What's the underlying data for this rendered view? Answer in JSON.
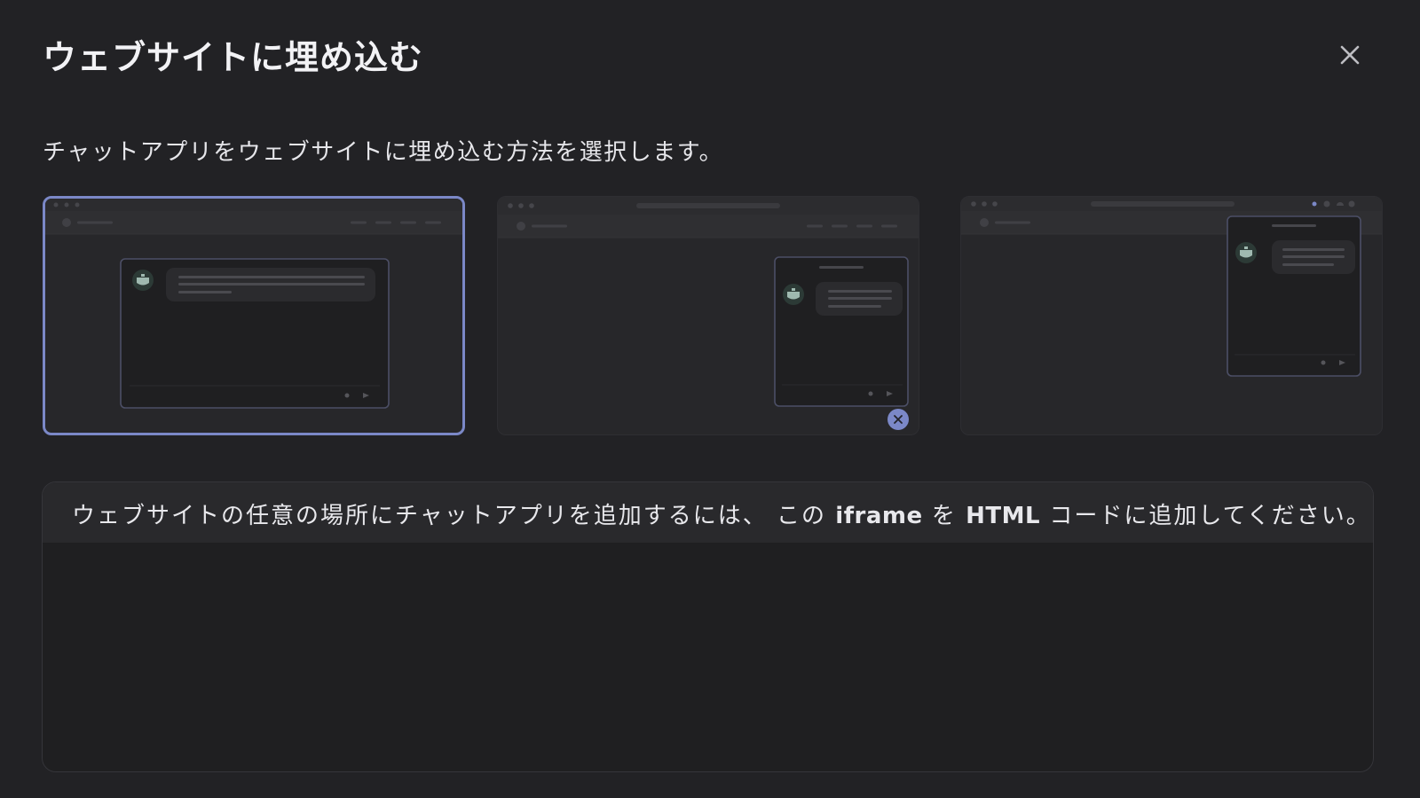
{
  "dialog": {
    "title": "ウェブサイトに埋め込む",
    "close_label": "×",
    "subtitle": "チャットアプリをウェブサイトに埋め込む方法を選択します。"
  },
  "options": [
    {
      "id": "iframe",
      "selected": true
    },
    {
      "id": "floating-bubble",
      "selected": false
    },
    {
      "id": "chrome-extension",
      "selected": false
    }
  ],
  "code_panel": {
    "instruction_part1": "ウェブサイトの任意の場所にチャットアプリを追加するには、 この ",
    "instruction_code1": "iframe",
    "instruction_part2": " を ",
    "instruction_code2": "HTML",
    "instruction_part3": " コードに追加してください。"
  },
  "colors": {
    "background": "#222225",
    "accent": "#7b88c7",
    "panel": "#27272a"
  },
  "icons": {
    "close": "close-icon",
    "bot": "bot-avatar-icon",
    "send": "send-icon",
    "attach": "attach-icon",
    "bubble_close": "close-icon"
  }
}
